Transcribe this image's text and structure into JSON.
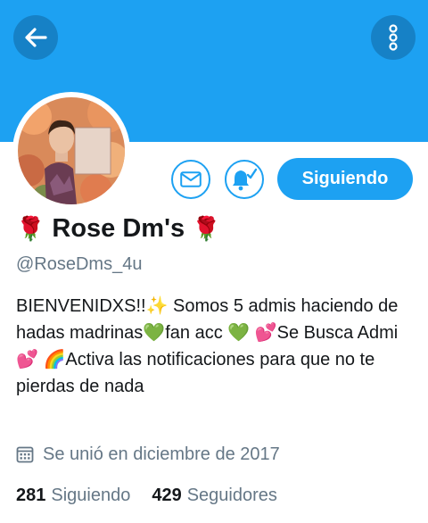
{
  "profile": {
    "name": "Rose Dm's",
    "name_prefix_emoji": "🌹",
    "name_suffix_emoji": "🌹",
    "handle": "@RoseDms_4u",
    "bio": "BIENVENIDXS!!✨ Somos 5 admis haciendo de hadas madrinas💚fan acc 💚 💕Se Busca Admi💕 🌈Activa las notificaciones para que no te pierdas de nada",
    "joined": "Se unió en diciembre de 2017",
    "following_count": "281",
    "following_label": "Siguiendo",
    "followers_count": "429",
    "followers_label": "Seguidores"
  },
  "actions": {
    "follow_label": "Siguiendo",
    "back_icon": "arrow-left-icon",
    "menu_icon": "more-vertical-icon",
    "message_icon": "envelope-icon",
    "notify_icon": "bell-check-icon"
  },
  "colors": {
    "brand": "#1da1f2",
    "icon_button_bg": "#1681c6",
    "secondary_text": "#657786",
    "primary_text": "#14171a"
  }
}
